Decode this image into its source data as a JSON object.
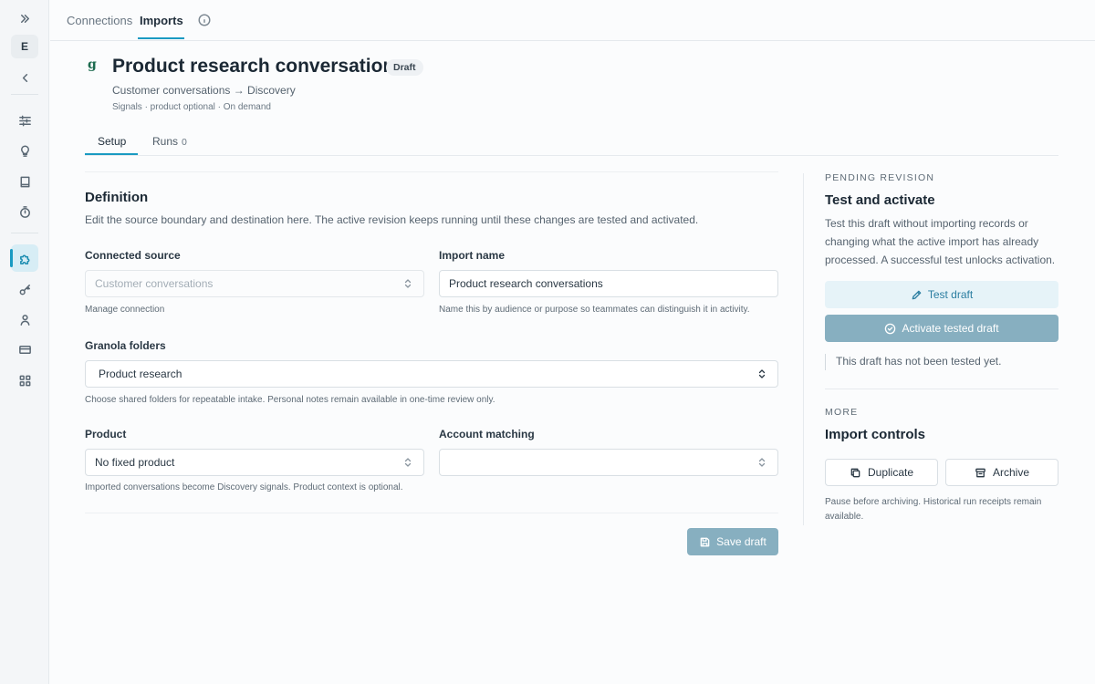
{
  "rail": {
    "avatar_letter": "E",
    "items": [
      {
        "icon": "chevrons-right-icon"
      },
      {
        "icon": "chevron-left-icon"
      },
      {
        "icon": "sliders-icon"
      },
      {
        "icon": "lightbulb-icon"
      },
      {
        "icon": "book-icon"
      },
      {
        "icon": "timer-icon"
      },
      {
        "icon": "puzzle-icon",
        "active": true
      },
      {
        "icon": "key-icon"
      },
      {
        "icon": "user-icon"
      },
      {
        "icon": "credit-card-icon"
      },
      {
        "icon": "grid-icon"
      }
    ]
  },
  "topnav": {
    "tabs": [
      {
        "label": "Connections"
      },
      {
        "label": "Imports",
        "active": true
      }
    ],
    "info_icon": "info-icon"
  },
  "header": {
    "logo_letter": "g",
    "title": "Product research conversations",
    "status_badge": "Draft",
    "subtitle": "Customer conversations → Discovery",
    "meta": "Signals · product optional · On demand"
  },
  "subtabs": [
    {
      "label": "Setup",
      "active": true
    },
    {
      "label": "Runs",
      "count": "0"
    }
  ],
  "definition": {
    "heading": "Definition",
    "description": "Edit the source boundary and destination here. The active revision keeps running until these changes are tested and activated.",
    "connected_source": {
      "label": "Connected source",
      "value": "Customer conversations",
      "help": "Manage connection"
    },
    "import_name": {
      "label": "Import name",
      "value": "Product research conversations",
      "help": "Name this by audience or purpose so teammates can distinguish it in activity."
    },
    "folders": {
      "label": "Granola folders",
      "value": "Product research",
      "help": "Choose shared folders for repeatable intake. Personal notes remain available in one-time review only."
    },
    "product": {
      "label": "Product",
      "value": "No fixed product",
      "help": "Imported conversations become Discovery signals. Product context is optional."
    },
    "account_matching": {
      "label": "Account matching",
      "value": ""
    },
    "save_label": "Save draft"
  },
  "pending": {
    "eyebrow": "PENDING REVISION",
    "heading": "Test and activate",
    "description": "Test this draft without importing records or changing what the active import has already processed. A successful test unlocks activation.",
    "test_label": "Test draft",
    "activate_label": "Activate tested draft",
    "note": "This draft has not been tested yet."
  },
  "more": {
    "eyebrow": "MORE",
    "heading": "Import controls",
    "duplicate_label": "Duplicate",
    "archive_label": "Archive",
    "note": "Pause before archiving. Historical run receipts remain available."
  },
  "colors": {
    "accent": "#1a9ac2",
    "primary_button": "#87afc0",
    "test_button_bg": "#e6f3f8"
  }
}
